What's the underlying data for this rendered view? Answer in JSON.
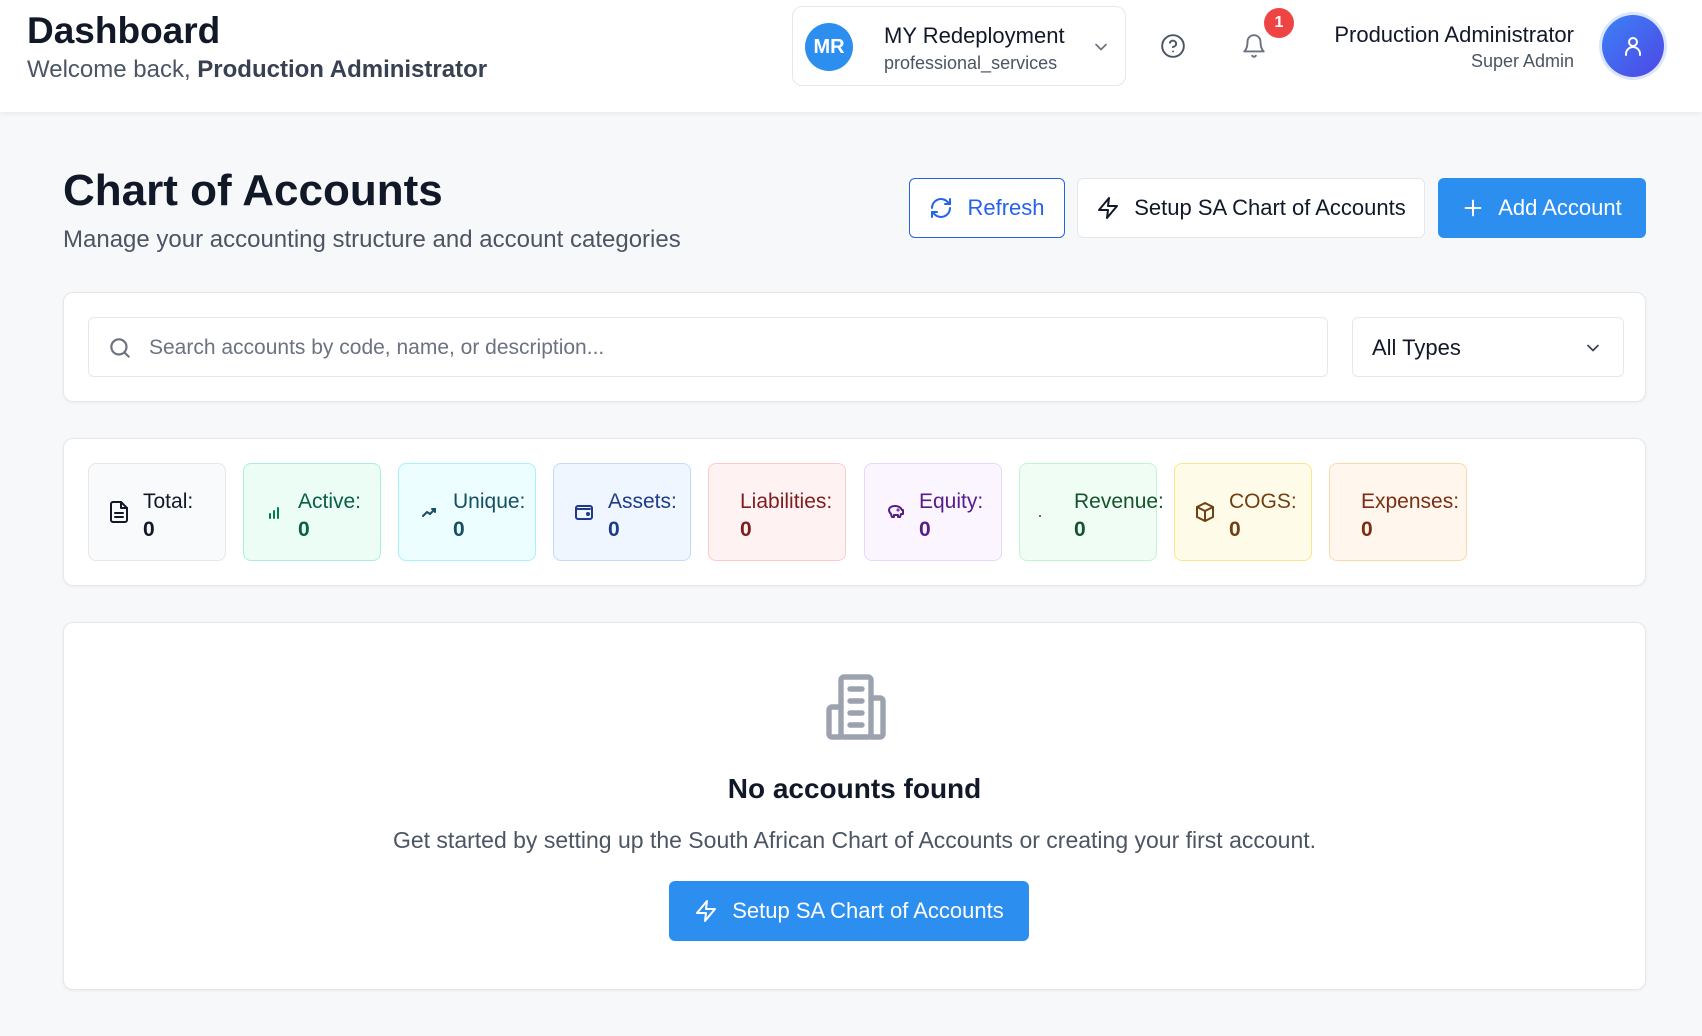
{
  "header": {
    "title": "Dashboard",
    "welcome_prefix": "Welcome back,",
    "welcome_name": "Production Administrator",
    "org": {
      "initials": "MR",
      "name": "MY Redeployment",
      "type": "professional_services",
      "avatar_color": "#2c8ff0"
    },
    "notifications": {
      "count": "1",
      "badge_color": "#ef4444"
    },
    "user": {
      "name": "Production Administrator",
      "role": "Super Admin"
    }
  },
  "page": {
    "title": "Chart of Accounts",
    "subtitle": "Manage your accounting structure and account categories",
    "actions": {
      "refresh_label": "Refresh",
      "setup_label": "Setup SA Chart of Accounts",
      "add_label": "Add Account"
    }
  },
  "filters": {
    "search_placeholder": "Search accounts by code, name, or description...",
    "search_value": "",
    "type_select": "All Types"
  },
  "stats": [
    {
      "label": "Total:",
      "value": "0",
      "icon": "document-icon",
      "bg": "#f9fafb",
      "border": "#e5e7eb",
      "color": "#111827"
    },
    {
      "label": "Active:",
      "value": "0",
      "icon": "bar-chart-icon",
      "bg": "#ecfdf5",
      "border": "#a7f3d0",
      "color": "#065f46"
    },
    {
      "label": "Unique:",
      "value": "0",
      "icon": "trending-up-icon",
      "bg": "#ecfeff",
      "border": "#a5f3fc",
      "color": "#164e63"
    },
    {
      "label": "Assets:",
      "value": "0",
      "icon": "wallet-icon",
      "bg": "#eff6ff",
      "border": "#bfdbfe",
      "color": "#1e3a8a"
    },
    {
      "label": "Liabilities:",
      "value": "0",
      "icon": "none",
      "bg": "#fef2f2",
      "border": "#fecaca",
      "color": "#7f1d1d"
    },
    {
      "label": "Equity:",
      "value": "0",
      "icon": "piggy-bank-icon",
      "bg": "#faf5ff",
      "border": "#e9d5ff",
      "color": "#581c87"
    },
    {
      "label": "Revenue:",
      "value": "0",
      "icon": "dot-icon",
      "bg": "#f0fdf4",
      "border": "#bbf7d0",
      "color": "#14532d"
    },
    {
      "label": "COGS:",
      "value": "0",
      "icon": "package-icon",
      "bg": "#fefce8",
      "border": "#fde68a",
      "color": "#713f12"
    },
    {
      "label": "Expenses:",
      "value": "0",
      "icon": "none",
      "bg": "#fff7ed",
      "border": "#fed7aa",
      "color": "#7c2d12"
    }
  ],
  "empty_state": {
    "icon": "building-icon",
    "title": "No accounts found",
    "description": "Get started by setting up the South African Chart of Accounts or creating your first account.",
    "button_label": "Setup SA Chart of Accounts"
  },
  "colors": {
    "primary": "#2c8ff0",
    "primary_outline": "#2563eb"
  }
}
